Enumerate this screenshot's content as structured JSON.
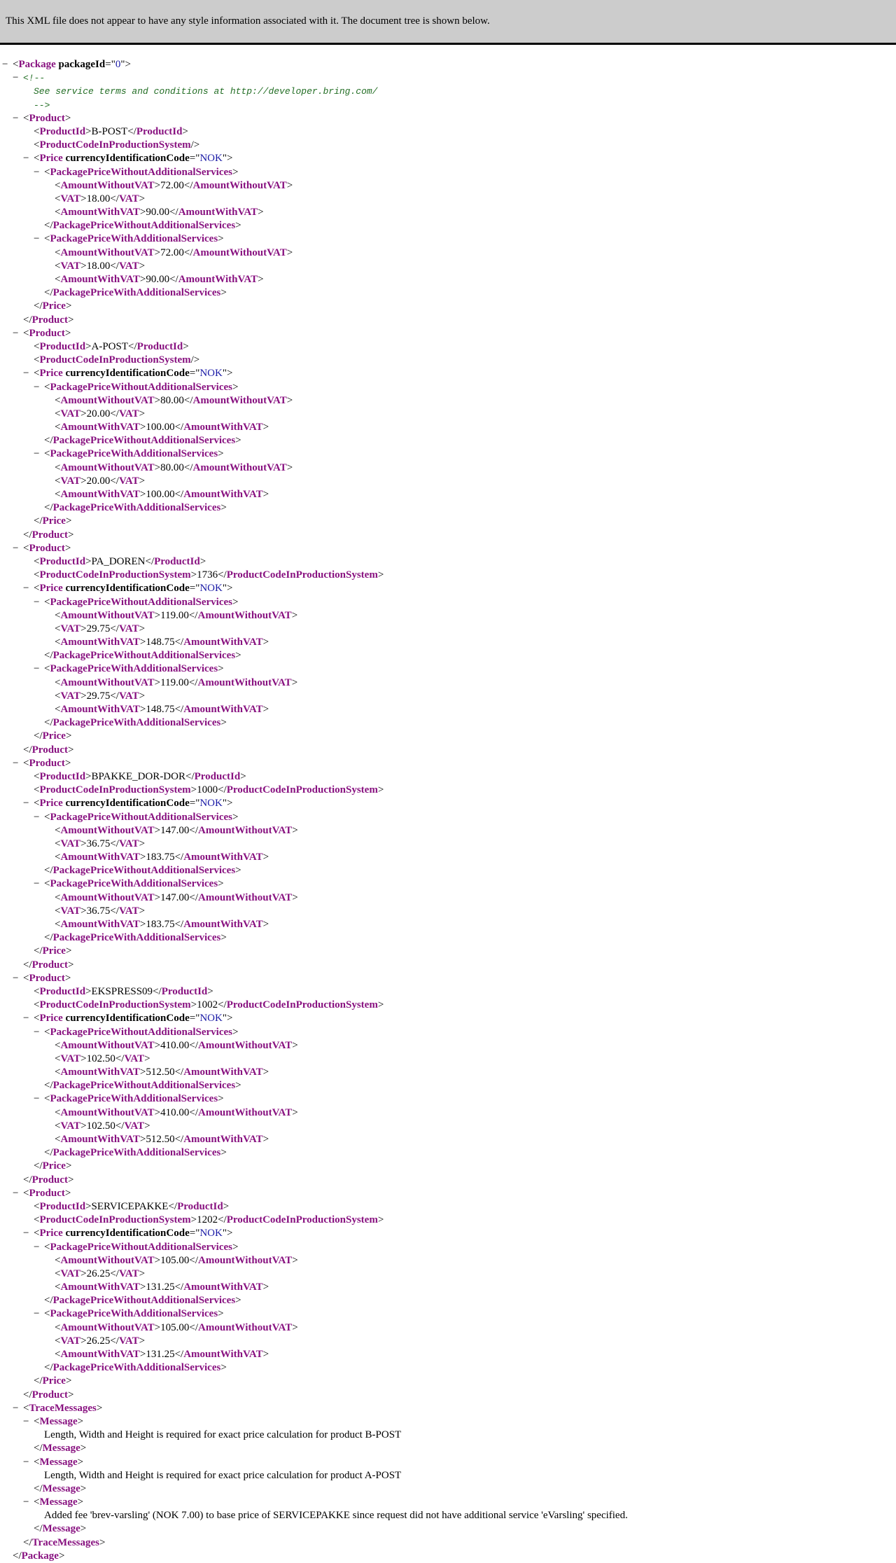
{
  "header": {
    "message": "This XML file does not appear to have any style information associated with it. The document tree is shown below."
  },
  "toggle_symbol": "−",
  "tree": {
    "lines": [
      {
        "indent": 0,
        "toggle": true,
        "type": "open",
        "tag": "Package",
        "attr": "packageId",
        "attrValue": "0"
      },
      {
        "indent": 1,
        "toggle": true,
        "type": "comment",
        "text": "<!--"
      },
      {
        "indent": 2,
        "type": "comment",
        "text": "See service terms and conditions at http://developer.bring.com/"
      },
      {
        "indent": 2,
        "type": "comment",
        "text": "-->"
      },
      {
        "indent": 1,
        "toggle": true,
        "type": "open",
        "tag": "Product"
      },
      {
        "indent": 2,
        "type": "leaf",
        "tag": "ProductId",
        "value": "B-POST"
      },
      {
        "indent": 2,
        "type": "empty",
        "tag": "ProductCodeInProductionSystem"
      },
      {
        "indent": 2,
        "toggle": true,
        "type": "open",
        "tag": "Price",
        "attr": "currencyIdentificationCode",
        "attrValue": "NOK"
      },
      {
        "indent": 3,
        "toggle": true,
        "type": "open",
        "tag": "PackagePriceWithoutAdditionalServices"
      },
      {
        "indent": 4,
        "type": "leaf",
        "tag": "AmountWithoutVAT",
        "value": "72.00"
      },
      {
        "indent": 4,
        "type": "leaf",
        "tag": "VAT",
        "value": "18.00"
      },
      {
        "indent": 4,
        "type": "leaf",
        "tag": "AmountWithVAT",
        "value": "90.00"
      },
      {
        "indent": 3,
        "type": "close",
        "tag": "PackagePriceWithoutAdditionalServices"
      },
      {
        "indent": 3,
        "toggle": true,
        "type": "open",
        "tag": "PackagePriceWithAdditionalServices"
      },
      {
        "indent": 4,
        "type": "leaf",
        "tag": "AmountWithoutVAT",
        "value": "72.00"
      },
      {
        "indent": 4,
        "type": "leaf",
        "tag": "VAT",
        "value": "18.00"
      },
      {
        "indent": 4,
        "type": "leaf",
        "tag": "AmountWithVAT",
        "value": "90.00"
      },
      {
        "indent": 3,
        "type": "close",
        "tag": "PackagePriceWithAdditionalServices"
      },
      {
        "indent": 2,
        "type": "close",
        "tag": "Price"
      },
      {
        "indent": 1,
        "type": "close",
        "tag": "Product"
      },
      {
        "indent": 1,
        "toggle": true,
        "type": "open",
        "tag": "Product"
      },
      {
        "indent": 2,
        "type": "leaf",
        "tag": "ProductId",
        "value": "A-POST"
      },
      {
        "indent": 2,
        "type": "empty",
        "tag": "ProductCodeInProductionSystem"
      },
      {
        "indent": 2,
        "toggle": true,
        "type": "open",
        "tag": "Price",
        "attr": "currencyIdentificationCode",
        "attrValue": "NOK"
      },
      {
        "indent": 3,
        "toggle": true,
        "type": "open",
        "tag": "PackagePriceWithoutAdditionalServices"
      },
      {
        "indent": 4,
        "type": "leaf",
        "tag": "AmountWithoutVAT",
        "value": "80.00"
      },
      {
        "indent": 4,
        "type": "leaf",
        "tag": "VAT",
        "value": "20.00"
      },
      {
        "indent": 4,
        "type": "leaf",
        "tag": "AmountWithVAT",
        "value": "100.00"
      },
      {
        "indent": 3,
        "type": "close",
        "tag": "PackagePriceWithoutAdditionalServices"
      },
      {
        "indent": 3,
        "toggle": true,
        "type": "open",
        "tag": "PackagePriceWithAdditionalServices"
      },
      {
        "indent": 4,
        "type": "leaf",
        "tag": "AmountWithoutVAT",
        "value": "80.00"
      },
      {
        "indent": 4,
        "type": "leaf",
        "tag": "VAT",
        "value": "20.00"
      },
      {
        "indent": 4,
        "type": "leaf",
        "tag": "AmountWithVAT",
        "value": "100.00"
      },
      {
        "indent": 3,
        "type": "close",
        "tag": "PackagePriceWithAdditionalServices"
      },
      {
        "indent": 2,
        "type": "close",
        "tag": "Price"
      },
      {
        "indent": 1,
        "type": "close",
        "tag": "Product"
      },
      {
        "indent": 1,
        "toggle": true,
        "type": "open",
        "tag": "Product"
      },
      {
        "indent": 2,
        "type": "leaf",
        "tag": "ProductId",
        "value": "PA_DOREN"
      },
      {
        "indent": 2,
        "type": "leaf",
        "tag": "ProductCodeInProductionSystem",
        "value": "1736"
      },
      {
        "indent": 2,
        "toggle": true,
        "type": "open",
        "tag": "Price",
        "attr": "currencyIdentificationCode",
        "attrValue": "NOK"
      },
      {
        "indent": 3,
        "toggle": true,
        "type": "open",
        "tag": "PackagePriceWithoutAdditionalServices"
      },
      {
        "indent": 4,
        "type": "leaf",
        "tag": "AmountWithoutVAT",
        "value": "119.00"
      },
      {
        "indent": 4,
        "type": "leaf",
        "tag": "VAT",
        "value": "29.75"
      },
      {
        "indent": 4,
        "type": "leaf",
        "tag": "AmountWithVAT",
        "value": "148.75"
      },
      {
        "indent": 3,
        "type": "close",
        "tag": "PackagePriceWithoutAdditionalServices"
      },
      {
        "indent": 3,
        "toggle": true,
        "type": "open",
        "tag": "PackagePriceWithAdditionalServices"
      },
      {
        "indent": 4,
        "type": "leaf",
        "tag": "AmountWithoutVAT",
        "value": "119.00"
      },
      {
        "indent": 4,
        "type": "leaf",
        "tag": "VAT",
        "value": "29.75"
      },
      {
        "indent": 4,
        "type": "leaf",
        "tag": "AmountWithVAT",
        "value": "148.75"
      },
      {
        "indent": 3,
        "type": "close",
        "tag": "PackagePriceWithAdditionalServices"
      },
      {
        "indent": 2,
        "type": "close",
        "tag": "Price"
      },
      {
        "indent": 1,
        "type": "close",
        "tag": "Product"
      },
      {
        "indent": 1,
        "toggle": true,
        "type": "open",
        "tag": "Product"
      },
      {
        "indent": 2,
        "type": "leaf",
        "tag": "ProductId",
        "value": "BPAKKE_DOR-DOR"
      },
      {
        "indent": 2,
        "type": "leaf",
        "tag": "ProductCodeInProductionSystem",
        "value": "1000"
      },
      {
        "indent": 2,
        "toggle": true,
        "type": "open",
        "tag": "Price",
        "attr": "currencyIdentificationCode",
        "attrValue": "NOK"
      },
      {
        "indent": 3,
        "toggle": true,
        "type": "open",
        "tag": "PackagePriceWithoutAdditionalServices"
      },
      {
        "indent": 4,
        "type": "leaf",
        "tag": "AmountWithoutVAT",
        "value": "147.00"
      },
      {
        "indent": 4,
        "type": "leaf",
        "tag": "VAT",
        "value": "36.75"
      },
      {
        "indent": 4,
        "type": "leaf",
        "tag": "AmountWithVAT",
        "value": "183.75"
      },
      {
        "indent": 3,
        "type": "close",
        "tag": "PackagePriceWithoutAdditionalServices"
      },
      {
        "indent": 3,
        "toggle": true,
        "type": "open",
        "tag": "PackagePriceWithAdditionalServices"
      },
      {
        "indent": 4,
        "type": "leaf",
        "tag": "AmountWithoutVAT",
        "value": "147.00"
      },
      {
        "indent": 4,
        "type": "leaf",
        "tag": "VAT",
        "value": "36.75"
      },
      {
        "indent": 4,
        "type": "leaf",
        "tag": "AmountWithVAT",
        "value": "183.75"
      },
      {
        "indent": 3,
        "type": "close",
        "tag": "PackagePriceWithAdditionalServices"
      },
      {
        "indent": 2,
        "type": "close",
        "tag": "Price"
      },
      {
        "indent": 1,
        "type": "close",
        "tag": "Product"
      },
      {
        "indent": 1,
        "toggle": true,
        "type": "open",
        "tag": "Product"
      },
      {
        "indent": 2,
        "type": "leaf",
        "tag": "ProductId",
        "value": "EKSPRESS09"
      },
      {
        "indent": 2,
        "type": "leaf",
        "tag": "ProductCodeInProductionSystem",
        "value": "1002"
      },
      {
        "indent": 2,
        "toggle": true,
        "type": "open",
        "tag": "Price",
        "attr": "currencyIdentificationCode",
        "attrValue": "NOK"
      },
      {
        "indent": 3,
        "toggle": true,
        "type": "open",
        "tag": "PackagePriceWithoutAdditionalServices"
      },
      {
        "indent": 4,
        "type": "leaf",
        "tag": "AmountWithoutVAT",
        "value": "410.00"
      },
      {
        "indent": 4,
        "type": "leaf",
        "tag": "VAT",
        "value": "102.50"
      },
      {
        "indent": 4,
        "type": "leaf",
        "tag": "AmountWithVAT",
        "value": "512.50"
      },
      {
        "indent": 3,
        "type": "close",
        "tag": "PackagePriceWithoutAdditionalServices"
      },
      {
        "indent": 3,
        "toggle": true,
        "type": "open",
        "tag": "PackagePriceWithAdditionalServices"
      },
      {
        "indent": 4,
        "type": "leaf",
        "tag": "AmountWithoutVAT",
        "value": "410.00"
      },
      {
        "indent": 4,
        "type": "leaf",
        "tag": "VAT",
        "value": "102.50"
      },
      {
        "indent": 4,
        "type": "leaf",
        "tag": "AmountWithVAT",
        "value": "512.50"
      },
      {
        "indent": 3,
        "type": "close",
        "tag": "PackagePriceWithAdditionalServices"
      },
      {
        "indent": 2,
        "type": "close",
        "tag": "Price"
      },
      {
        "indent": 1,
        "type": "close",
        "tag": "Product"
      },
      {
        "indent": 1,
        "toggle": true,
        "type": "open",
        "tag": "Product"
      },
      {
        "indent": 2,
        "type": "leaf",
        "tag": "ProductId",
        "value": "SERVICEPAKKE"
      },
      {
        "indent": 2,
        "type": "leaf",
        "tag": "ProductCodeInProductionSystem",
        "value": "1202"
      },
      {
        "indent": 2,
        "toggle": true,
        "type": "open",
        "tag": "Price",
        "attr": "currencyIdentificationCode",
        "attrValue": "NOK"
      },
      {
        "indent": 3,
        "toggle": true,
        "type": "open",
        "tag": "PackagePriceWithoutAdditionalServices"
      },
      {
        "indent": 4,
        "type": "leaf",
        "tag": "AmountWithoutVAT",
        "value": "105.00"
      },
      {
        "indent": 4,
        "type": "leaf",
        "tag": "VAT",
        "value": "26.25"
      },
      {
        "indent": 4,
        "type": "leaf",
        "tag": "AmountWithVAT",
        "value": "131.25"
      },
      {
        "indent": 3,
        "type": "close",
        "tag": "PackagePriceWithoutAdditionalServices"
      },
      {
        "indent": 3,
        "toggle": true,
        "type": "open",
        "tag": "PackagePriceWithAdditionalServices"
      },
      {
        "indent": 4,
        "type": "leaf",
        "tag": "AmountWithoutVAT",
        "value": "105.00"
      },
      {
        "indent": 4,
        "type": "leaf",
        "tag": "VAT",
        "value": "26.25"
      },
      {
        "indent": 4,
        "type": "leaf",
        "tag": "AmountWithVAT",
        "value": "131.25"
      },
      {
        "indent": 3,
        "type": "close",
        "tag": "PackagePriceWithAdditionalServices"
      },
      {
        "indent": 2,
        "type": "close",
        "tag": "Price"
      },
      {
        "indent": 1,
        "type": "close",
        "tag": "Product"
      },
      {
        "indent": 1,
        "toggle": true,
        "type": "open",
        "tag": "TraceMessages"
      },
      {
        "indent": 2,
        "toggle": true,
        "type": "open",
        "tag": "Message"
      },
      {
        "indent": 3,
        "type": "text",
        "text": "Length, Width and Height is required for exact price calculation for product B-POST"
      },
      {
        "indent": 2,
        "type": "close",
        "tag": "Message"
      },
      {
        "indent": 2,
        "toggle": true,
        "type": "open",
        "tag": "Message"
      },
      {
        "indent": 3,
        "type": "text",
        "text": "Length, Width and Height is required for exact price calculation for product A-POST"
      },
      {
        "indent": 2,
        "type": "close",
        "tag": "Message"
      },
      {
        "indent": 2,
        "toggle": true,
        "type": "open",
        "tag": "Message"
      },
      {
        "indent": 3,
        "type": "text",
        "text": "Added fee 'brev-varsling' (NOK 7.00) to base price of SERVICEPAKKE since request did not have additional service 'eVarsling' specified."
      },
      {
        "indent": 2,
        "type": "close",
        "tag": "Message"
      },
      {
        "indent": 1,
        "type": "close",
        "tag": "TraceMessages"
      },
      {
        "indent": 0,
        "type": "close",
        "tag": "Package"
      }
    ]
  }
}
